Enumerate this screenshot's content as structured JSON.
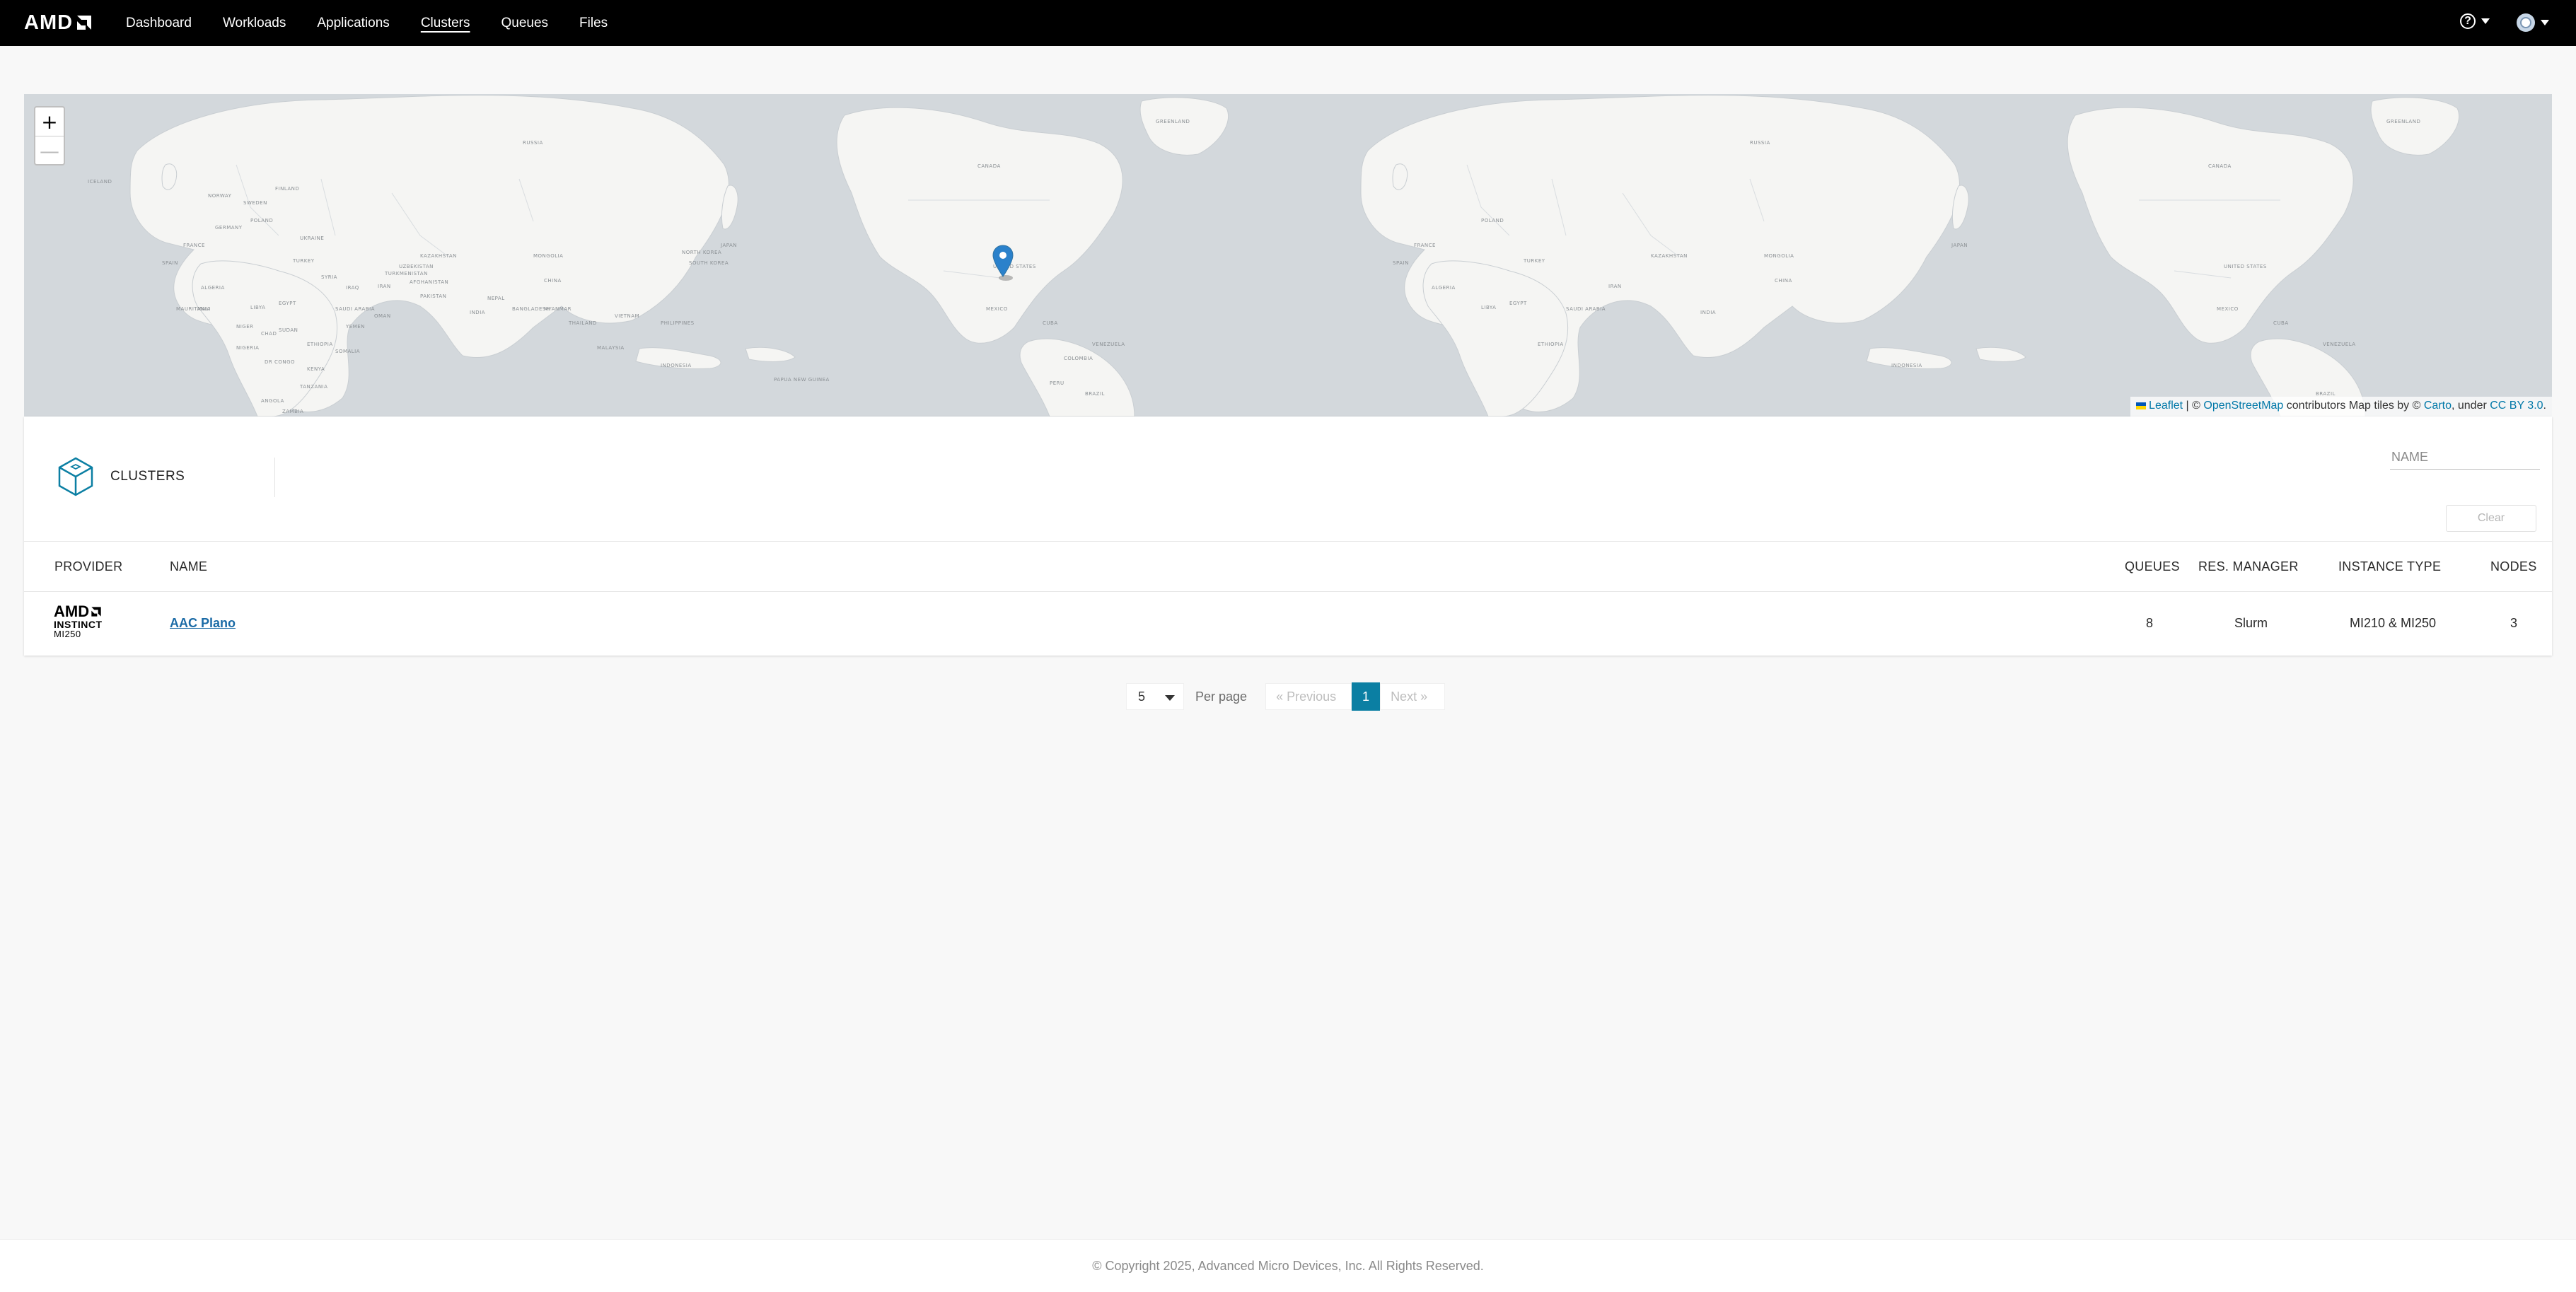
{
  "brand": {
    "logo_text": "AMD"
  },
  "nav": {
    "items": [
      {
        "label": "Dashboard",
        "active": false
      },
      {
        "label": "Workloads",
        "active": false
      },
      {
        "label": "Applications",
        "active": false
      },
      {
        "label": "Clusters",
        "active": true
      },
      {
        "label": "Queues",
        "active": false
      },
      {
        "label": "Files",
        "active": false
      }
    ]
  },
  "map": {
    "zoom_in": "+",
    "zoom_out": "—",
    "attribution": {
      "leaflet": "Leaflet",
      "sep": " | © ",
      "osm": "OpenStreetMap",
      "mid": " contributors Map tiles by © ",
      "carto": "Carto",
      "under": ", under ",
      "license": "CC BY 3.0",
      "end": "."
    },
    "labels": [
      "RUSSIA",
      "CANADA",
      "UNITED STATES",
      "MEXICO",
      "BRAZIL",
      "CHINA",
      "INDIA",
      "KAZAKHSTAN",
      "MONGOLIA",
      "ALGERIA",
      "LIBYA",
      "EGYPT",
      "SUDAN",
      "NIGER",
      "CHAD",
      "NIGERIA",
      "ETHIOPIA",
      "KENYA",
      "TANZANIA",
      "ANGOLA",
      "ZAMBIA",
      "IRAN",
      "SAUDI ARABIA",
      "PAKISTAN",
      "AFGHANISTAN",
      "TURKEY",
      "UKRAINE",
      "POLAND",
      "GERMANY",
      "FRANCE",
      "SPAIN",
      "FINLAND",
      "SWEDEN",
      "NORWAY",
      "ICELAND",
      "JAPAN",
      "PHILIPPINES",
      "INDONESIA",
      "MALAYSIA",
      "THAILAND",
      "VIETNAM",
      "MYANMAR",
      "CUBA",
      "VENEZUELA",
      "COLOMBIA",
      "PERU",
      "GREENLAND",
      "MALI",
      "MAURITANIA",
      "DR CONGO",
      "SOMALIA",
      "YEMEN",
      "OMAN",
      "IRAQ",
      "SYRIA",
      "UZBEKISTAN",
      "TURKMENISTAN",
      "NEPAL",
      "BANGLADESH",
      "SOUTH KOREA",
      "NORTH KOREA",
      "PAPUA NEW GUINEA"
    ],
    "marker": "map-marker-icon"
  },
  "clusters": {
    "title": "CLUSTERS",
    "filter_placeholder": "NAME",
    "clear_label": "Clear",
    "columns": {
      "provider": "PROVIDER",
      "name": "NAME",
      "queues": "QUEUES",
      "res_manager": "RES. MANAGER",
      "instance_type": "INSTANCE TYPE",
      "nodes": "NODES"
    },
    "rows": [
      {
        "provider_logo": {
          "brand": "AMD",
          "line1": "INSTINCT",
          "line2": "MI250"
        },
        "name": "AAC Plano",
        "queues": "8",
        "res_manager": "Slurm",
        "instance_type": "MI210 & MI250",
        "nodes": "3"
      }
    ]
  },
  "pagination": {
    "per_page_value": "5",
    "per_page_label": "Per page",
    "prev_label": "« Previous",
    "current_page": "1",
    "next_label": "Next »"
  },
  "footer": {
    "copyright": "© Copyright 2025, Advanced Micro Devices, Inc. All Rights Reserved."
  },
  "colors": {
    "accent": "#0b7fa3",
    "link": "#1b6ba6",
    "topbar": "#000000",
    "map_water": "#d3d8dc",
    "map_land": "#f5f5f3",
    "marker": "#2a81cb"
  }
}
